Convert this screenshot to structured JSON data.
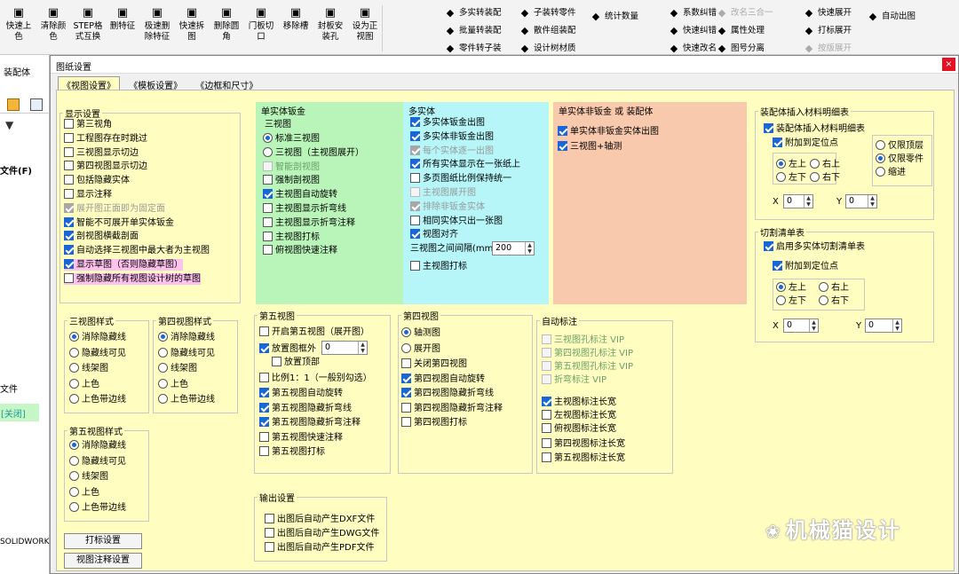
{
  "toolbar": {
    "buttons": [
      {
        "label": "快速上色",
        "icon": "paint-icon"
      },
      {
        "label": "清除颜色",
        "icon": "palette-icon"
      },
      {
        "label": "STEP格式互换",
        "icon": "step-icon"
      },
      {
        "label": "删特征",
        "icon": "delete-feature-icon"
      },
      {
        "label": "极速删除特征",
        "icon": "fast-delete-icon"
      },
      {
        "label": "快速拆图",
        "icon": "split-drawing-icon"
      },
      {
        "label": "删除圆角",
        "icon": "fillet-delete-icon"
      },
      {
        "label": "门板切口",
        "icon": "door-cut-icon"
      },
      {
        "label": "移除槽",
        "icon": "remove-slot-icon"
      },
      {
        "label": "封板安装孔",
        "icon": "hole-icon"
      },
      {
        "label": "设为正视图",
        "icon": "front-view-icon"
      }
    ],
    "rows": [
      {
        "label": "多实转装配",
        "icon": "assembly-icon"
      },
      {
        "label": "子装转零件",
        "icon": "part-icon"
      },
      {
        "label": "批量转装配",
        "icon": "batch-icon"
      },
      {
        "label": "散件组装配",
        "icon": "combine-icon"
      },
      {
        "label": "零件转子装",
        "icon": "part-sub-icon"
      },
      {
        "label": "设计树材质",
        "icon": "material-icon"
      },
      {
        "label": "统计数量",
        "icon": "count-icon"
      },
      {
        "label": "系数纠错",
        "icon": "fix-icon"
      },
      {
        "label": "改名三合一",
        "icon": "rename-icon"
      },
      {
        "label": "快速纠错",
        "icon": "quick-fix-icon"
      },
      {
        "label": "属性处理",
        "icon": "property-icon"
      },
      {
        "label": "快速改名",
        "icon": "quick-rename-icon"
      },
      {
        "label": "图号分离",
        "icon": "separate-icon"
      },
      {
        "label": "快速展开",
        "icon": "expand-icon"
      },
      {
        "label": "打标展开",
        "icon": "mark-expand-icon"
      },
      {
        "label": "按版展开",
        "icon": "version-expand-icon"
      },
      {
        "label": "自动出图",
        "icon": "auto-drawing-icon"
      }
    ]
  },
  "leftpane": {
    "tab": "装配体",
    "file_label": "文件(F)",
    "file2": "文件",
    "closed": "[关闭]",
    "solidworks": "SOLIDWORK"
  },
  "dialog": {
    "title": "图纸设置",
    "close": "×",
    "tabs": [
      "《视图设置》",
      "《模板设置》",
      "《边框和尺寸》"
    ],
    "display": {
      "title": "显示设置",
      "items": [
        {
          "label": "第三视角",
          "state": "off"
        },
        {
          "label": "工程图存在时跳过",
          "state": "off"
        },
        {
          "label": "三视图显示切边",
          "state": "off"
        },
        {
          "label": "第四视图显示切边",
          "state": "off"
        },
        {
          "label": "包括隐藏实体",
          "state": "off"
        },
        {
          "label": "显示注释",
          "state": "off"
        },
        {
          "label": "展开图正面即为固定面",
          "state": "dison"
        },
        {
          "label": "智能不可展开单实体钣金",
          "state": "on"
        },
        {
          "label": "剖视图横截剖面",
          "state": "on"
        },
        {
          "label": "自动选择三视图中最大者为主视图",
          "state": "on"
        },
        {
          "label": "显示草图（否则隐藏草图）",
          "state": "on"
        },
        {
          "label": "强制隐藏所有视图设计树的草图",
          "state": "off"
        }
      ]
    },
    "single_sheet": {
      "title": "单实体钣金",
      "sub": "三视图",
      "items": [
        {
          "label": "标准三视图",
          "kind": "radio",
          "state": "on"
        },
        {
          "label": "三视图（主视图展开）",
          "kind": "radio",
          "state": "off"
        },
        {
          "label": "智能剖视图",
          "kind": "check",
          "state": "dis"
        },
        {
          "label": "强制剖视图",
          "kind": "check",
          "state": "off"
        },
        {
          "label": "主视图自动旋转",
          "kind": "check",
          "state": "on"
        },
        {
          "label": "主视图显示折弯线",
          "kind": "check",
          "state": "off"
        },
        {
          "label": "主视图显示折弯注释",
          "kind": "check",
          "state": "off"
        },
        {
          "label": "主视图打标",
          "kind": "check",
          "state": "off"
        },
        {
          "label": "俯视图快速注释",
          "kind": "check",
          "state": "off"
        }
      ]
    },
    "multi": {
      "title": "多实体",
      "items": [
        {
          "label": "多实体钣金出图",
          "state": "on"
        },
        {
          "label": "多实体非钣金出图",
          "state": "on"
        },
        {
          "label": "每个实体逐一出图",
          "state": "dison"
        },
        {
          "label": "所有实体显示在一张纸上",
          "state": "on"
        },
        {
          "label": "多页图纸比例保持统一",
          "state": "off"
        },
        {
          "label": "主视图展开图",
          "state": "dis"
        },
        {
          "label": "排除非钣金实体",
          "state": "dison"
        },
        {
          "label": "相同实体只出一张图",
          "state": "off"
        },
        {
          "label": "视图对齐",
          "state": "on"
        }
      ],
      "gap_label": "三视图之间间隔(mm)",
      "gap_value": "200",
      "mark_label": "主视图打标"
    },
    "nonsheet": {
      "title": "单实体非钣金 或 装配体",
      "items": [
        {
          "label": "单实体非钣金实体出图",
          "state": "on"
        },
        {
          "label": "三视图+轴测",
          "state": "on"
        }
      ]
    },
    "bom": {
      "title": "装配体插入材料明细表",
      "insert": "装配体插入材料明细表",
      "attach": "附加到定位点",
      "corners": [
        "左上",
        "右上",
        "左下",
        "右下"
      ],
      "scope": [
        "仅限顶层",
        "仅限零件",
        "缩进"
      ],
      "x_label": "X",
      "x_value": "0",
      "y_label": "Y",
      "y_value": "0"
    },
    "cut": {
      "title": "切割清单表",
      "enable": "启用多实体切割清单表",
      "attach": "附加到定位点",
      "corners": [
        "左上",
        "右上",
        "左下",
        "右下"
      ],
      "x_label": "X",
      "x_value": "0",
      "y_label": "Y",
      "y_value": "0"
    },
    "style3": {
      "title": "三视图样式",
      "items": [
        "消除隐藏线",
        "隐藏线可见",
        "线架图",
        "上色",
        "上色带边线"
      ]
    },
    "style4": {
      "title": "第四视图样式",
      "items": [
        "消除隐藏线",
        "隐藏线可见",
        "线架图",
        "上色",
        "上色带边线"
      ]
    },
    "style5": {
      "title": "第五视图样式",
      "items": [
        "消除隐藏线",
        "隐藏线可见",
        "线架图",
        "上色",
        "上色带边线"
      ]
    },
    "fifth": {
      "title": "第五视图",
      "open": "开启第五视图（展开图）",
      "outside": "放置图框外",
      "outside_value": "0",
      "top": "放置顶部",
      "ratio": "比例1：1（一般别勾选）",
      "items": [
        {
          "label": "第五视图自动旋转",
          "state": "on"
        },
        {
          "label": "第五视图隐藏折弯线",
          "state": "on"
        },
        {
          "label": "第五视图隐藏折弯注释",
          "state": "on"
        },
        {
          "label": "第五视图快速注释",
          "state": "off"
        },
        {
          "label": "第五视图打标",
          "state": "off"
        }
      ]
    },
    "fourth": {
      "title": "第四视图",
      "radios": [
        "轴测图",
        "展开图"
      ],
      "items": [
        {
          "label": "关闭第四视图",
          "state": "off"
        },
        {
          "label": "第四视图自动旋转",
          "state": "on"
        },
        {
          "label": "第四视图隐藏折弯线",
          "state": "on"
        },
        {
          "label": "第四视图隐藏折弯注释",
          "state": "off"
        },
        {
          "label": "第四视图打标",
          "state": "off"
        }
      ]
    },
    "autodim": {
      "title": "自动标注",
      "vip": [
        {
          "label": "三视图孔标注 VIP"
        },
        {
          "label": "第四视图孔标注 VIP"
        },
        {
          "label": "第五视图孔标注 VIP"
        },
        {
          "label": "折弯标注 VIP"
        }
      ],
      "items": [
        {
          "label": "主视图标注长宽",
          "state": "on"
        },
        {
          "label": "左视图标注长宽",
          "state": "off"
        },
        {
          "label": "俯视图标注长宽",
          "state": "off"
        },
        {
          "label": "第四视图标注长宽",
          "state": "off"
        },
        {
          "label": "第五视图标注长宽",
          "state": "off"
        }
      ]
    },
    "output": {
      "title": "输出设置",
      "items": [
        "出图后自动产生DXF文件",
        "出图后自动产生DWG文件",
        "出图后自动产生PDF文件"
      ]
    },
    "buttons": {
      "print": "打标设置",
      "annot": "视图注释设置"
    }
  },
  "watermark": "机械猫设计",
  "colors": {
    "green": "#b9f4b9",
    "cyan": "#b6f5f8",
    "salmon": "#f9c9ad",
    "yellow": "#fffdc0",
    "checkblue": "#1a66d6",
    "pink": "#ffc2ee"
  }
}
